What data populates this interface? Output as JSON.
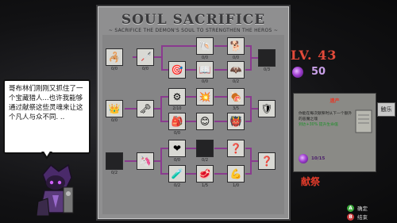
{
  "panel": {
    "title": "SOUL SACRIFICE",
    "subtitle": "~ SACRIFICE THE DEMON'S SOUL TO STRENGTHEN THE HEROS ~"
  },
  "dialog": {
    "text": "哥布林们刚刚又抓住了一个宝藏猎人...也许我能够通过献祭这些灵魂来让这个凡人与众不同. .."
  },
  "player": {
    "level_label": "LV. 43",
    "souls": "50"
  },
  "info": {
    "title": "遗产",
    "body_line1": "你能在每次献祭时从下一个额外的恶魔之魂",
    "body_line2": "到达+30% 提升生命值",
    "cost": "10/15"
  },
  "buttons": {
    "sacrifice": "献祭",
    "side_tab": "触乐",
    "confirm": "确定",
    "exit": "结束"
  },
  "nodes": [
    {
      "id": "n1",
      "icon": "🦂",
      "count": "0/0",
      "tag": "",
      "dark": false
    },
    {
      "id": "n2",
      "icon": "🦯",
      "count": "0/0",
      "tag": "",
      "dark": false
    },
    {
      "id": "n3",
      "icon": "🐚",
      "count": "0/0",
      "tag": "",
      "dark": false
    },
    {
      "id": "n4",
      "icon": "💀",
      "count": "0/0",
      "tag": "",
      "dark": false
    },
    {
      "id": "n5",
      "icon": "🐕",
      "count": "0/0",
      "tag": "",
      "dark": false
    },
    {
      "id": "n6",
      "icon": "",
      "count": "0/3",
      "tag": "",
      "dark": true
    },
    {
      "id": "n7",
      "icon": "🎯",
      "count": "",
      "tag": "",
      "dark": false
    },
    {
      "id": "n8",
      "icon": "📖",
      "count": "0/0",
      "tag": "",
      "dark": false
    },
    {
      "id": "n9",
      "icon": "🦇",
      "count": "0/2",
      "tag": "",
      "dark": false
    },
    {
      "id": "n10",
      "icon": "👑",
      "count": "0/0",
      "tag": "",
      "dark": false
    },
    {
      "id": "n11",
      "icon": "🗝",
      "count": "",
      "tag": "",
      "dark": false
    },
    {
      "id": "n12",
      "icon": "⚙",
      "count": "2/10",
      "tag": "",
      "dark": false
    },
    {
      "id": "n13",
      "icon": "💥",
      "count": "",
      "tag": "",
      "dark": false
    },
    {
      "id": "n14",
      "icon": "🍖",
      "count": "3/5",
      "tag": "",
      "dark": false
    },
    {
      "id": "n15",
      "icon": "🛡",
      "count": "",
      "tag": "",
      "dark": false
    },
    {
      "id": "n16",
      "icon": "🎒",
      "count": "0/0",
      "tag": "",
      "dark": false
    },
    {
      "id": "n17",
      "icon": "⚔",
      "count": "",
      "tag": "",
      "dark": false
    },
    {
      "id": "n18",
      "icon": "😊",
      "count": "",
      "tag": "",
      "dark": false
    },
    {
      "id": "n19",
      "icon": "👹",
      "count": "",
      "tag": "",
      "dark": false
    },
    {
      "id": "n20",
      "icon": "",
      "count": "0/2",
      "tag": "",
      "dark": true
    },
    {
      "id": "n21",
      "icon": "🦄",
      "count": "",
      "tag": "",
      "dark": false
    },
    {
      "id": "n22",
      "icon": "❤",
      "count": "0/0",
      "tag": "",
      "dark": false
    },
    {
      "id": "n23",
      "icon": "",
      "count": "0/2",
      "tag": "",
      "dark": true
    },
    {
      "id": "n24",
      "icon": "❓",
      "count": "",
      "tag": "",
      "dark": false
    },
    {
      "id": "n25",
      "icon": "❓",
      "count": "",
      "tag": "",
      "dark": false
    },
    {
      "id": "n26",
      "icon": "🧪",
      "count": "0/2",
      "tag": "",
      "dark": false
    },
    {
      "id": "n27",
      "icon": "🥩",
      "count": "1/5",
      "tag": "",
      "dark": false
    },
    {
      "id": "n28",
      "icon": "💪",
      "count": "1/0",
      "tag": "",
      "dark": false
    },
    {
      "id": "n29",
      "icon": "❓",
      "count": "",
      "tag": "",
      "dark": false
    }
  ],
  "colors": {
    "accent_red": "#e24a3a",
    "soul_purple": "#a040d0",
    "panel_gray": "#8f8f90",
    "link_purple": "#8a3a8f"
  }
}
